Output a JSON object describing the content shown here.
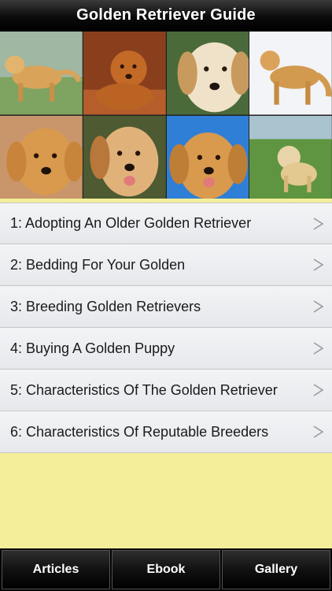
{
  "header": {
    "title": "Golden Retriever Guide"
  },
  "gallery": {
    "photos": [
      "golden-retriever-standing-on-grass",
      "golden-retriever-lying-on-wood-floor",
      "golden-retriever-face-closeup",
      "golden-retriever-standing-in-snow",
      "golden-retriever-puppy-portrait",
      "golden-retriever-panting-portrait",
      "golden-retriever-blue-sky-portrait",
      "golden-retriever-on-grass-by-water"
    ]
  },
  "articles": [
    {
      "label": "1: Adopting An Older Golden Retriever"
    },
    {
      "label": "2: Bedding For Your Golden"
    },
    {
      "label": "3: Breeding Golden Retrievers"
    },
    {
      "label": "4: Buying A Golden Puppy"
    },
    {
      "label": "5: Characteristics Of The Golden Retriever"
    },
    {
      "label": "6: Characteristics Of Reputable Breeders"
    }
  ],
  "tabs": [
    {
      "label": "Articles"
    },
    {
      "label": "Ebook"
    },
    {
      "label": "Gallery"
    }
  ],
  "colors": {
    "background": "#f4ee9b",
    "bar": "#000000",
    "list_item": "#eceef1"
  }
}
